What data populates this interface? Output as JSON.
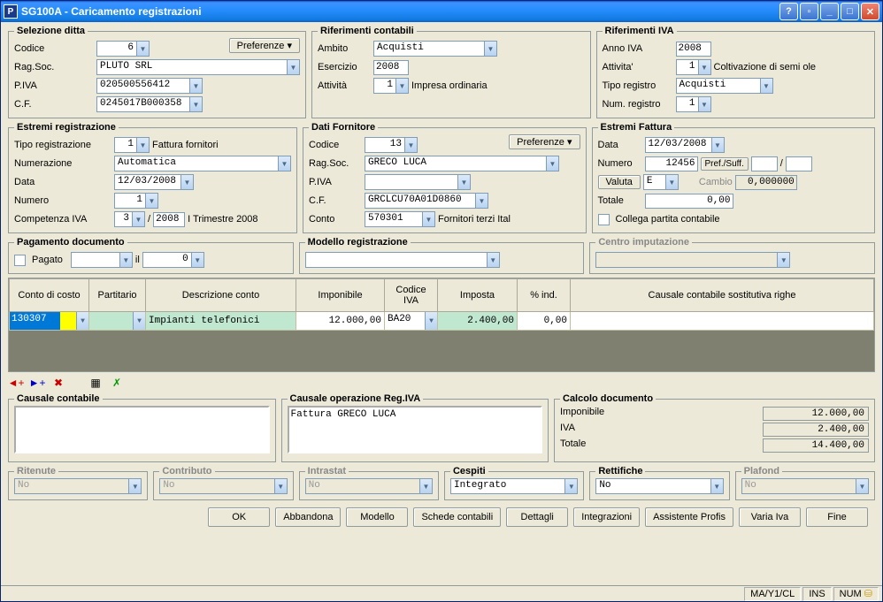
{
  "window": {
    "code": "SG100A",
    "title": "Caricamento registrazioni"
  },
  "prefs_label": "Preferenze",
  "selezione_ditta": {
    "legend": "Selezione ditta",
    "codice_lbl": "Codice",
    "codice": "6",
    "ragsoc_lbl": "Rag.Soc.",
    "ragsoc": "PLUTO SRL",
    "piva_lbl": "P.IVA",
    "piva": "020500556412",
    "cf_lbl": "C.F.",
    "cf": "0245017B000358"
  },
  "rif_contabili": {
    "legend": "Riferimenti contabili",
    "ambito_lbl": "Ambito",
    "ambito": "Acquisti",
    "esercizio_lbl": "Esercizio",
    "esercizio": "2008",
    "attivita_lbl": "Attività",
    "attivita": "1",
    "attivita_desc": "Impresa ordinaria"
  },
  "rif_iva": {
    "legend": "Riferimenti IVA",
    "anno_lbl": "Anno IVA",
    "anno": "2008",
    "attivita_lbl": "Attivita'",
    "attivita": "1",
    "attivita_desc": "Coltivazione di semi ole",
    "tipo_lbl": "Tipo registro",
    "tipo": "Acquisti",
    "num_lbl": "Num. registro",
    "num": "1"
  },
  "estremi_reg": {
    "legend": "Estremi registrazione",
    "tipo_lbl": "Tipo registrazione",
    "tipo": "1",
    "tipo_desc": "Fattura fornitori",
    "numer_lbl": "Numerazione",
    "numer": "Automatica",
    "data_lbl": "Data",
    "data": "12/03/2008",
    "numero_lbl": "Numero",
    "numero": "1",
    "comp_lbl": "Competenza IVA",
    "comp_m": "3",
    "comp_y": "2008",
    "comp_desc": "I Trimestre 2008"
  },
  "dati_fornitore": {
    "legend": "Dati Fornitore",
    "codice_lbl": "Codice",
    "codice": "13",
    "ragsoc_lbl": "Rag.Soc.",
    "ragsoc": "GRECO LUCA",
    "piva_lbl": "P.IVA",
    "piva": "",
    "cf_lbl": "C.F.",
    "cf": "GRCLCU70A01D0860",
    "conto_lbl": "Conto",
    "conto": "570301",
    "conto_desc": "Fornitori terzi Ital"
  },
  "estremi_fattura": {
    "legend": "Estremi Fattura",
    "data_lbl": "Data",
    "data": "12/03/2008",
    "numero_lbl": "Numero",
    "numero": "12456",
    "prefsuff_btn": "Pref./Suff.",
    "slash": "/",
    "valuta_btn": "Valuta",
    "valuta": "E",
    "cambio_lbl": "Cambio",
    "cambio": "0,000000",
    "totale_lbl": "Totale",
    "totale": "0,00",
    "collega_lbl": "Collega partita contabile"
  },
  "pagamento": {
    "legend": "Pagamento documento",
    "pagato_lbl": "Pagato",
    "il_lbl": "il",
    "val": "0"
  },
  "modello": {
    "legend": "Modello registrazione"
  },
  "centro": {
    "legend": "Centro imputazione"
  },
  "grid": {
    "headers": {
      "conto": "Conto di costo",
      "part": "Partitario",
      "desc": "Descrizione conto",
      "impon": "Imponibile",
      "civa": "Codice IVA",
      "imposta": "Imposta",
      "pind": "% ind.",
      "causale": "Causale contabile sostitutiva righe"
    },
    "row": {
      "conto": "130307",
      "desc": "Impianti telefonici",
      "impon": "12.000,00",
      "civa": "BA20",
      "imposta": "2.400,00",
      "pind": "0,00"
    }
  },
  "causale_cont": {
    "legend": "Causale contabile",
    "text": ""
  },
  "causale_iva": {
    "legend": "Causale operazione Reg.IVA",
    "text": "Fattura GRECO LUCA"
  },
  "calcolo": {
    "legend": "Calcolo documento",
    "impon_lbl": "Imponibile",
    "impon": "12.000,00",
    "iva_lbl": "IVA",
    "iva": "2.400,00",
    "tot_lbl": "Totale",
    "tot": "14.400,00"
  },
  "dropdowns": {
    "ritenute": {
      "legend": "Ritenute",
      "val": "No"
    },
    "contributo": {
      "legend": "Contributo",
      "val": "No"
    },
    "intrastat": {
      "legend": "Intrastat",
      "val": "No"
    },
    "cespiti": {
      "legend": "Cespiti",
      "val": "Integrato"
    },
    "rettifiche": {
      "legend": "Rettifiche",
      "val": "No"
    },
    "plafond": {
      "legend": "Plafond",
      "val": "No"
    }
  },
  "actions": {
    "ok": "OK",
    "abbandona": "Abbandona",
    "modello": "Modello",
    "schede": "Schede contabili",
    "dettagli": "Dettagli",
    "integr": "Integrazioni",
    "assist": "Assistente Profis",
    "varia": "Varia Iva",
    "fine": "Fine"
  },
  "status": {
    "s1": "MA/Y1/CL",
    "s2": "INS",
    "s3": "NUM"
  }
}
